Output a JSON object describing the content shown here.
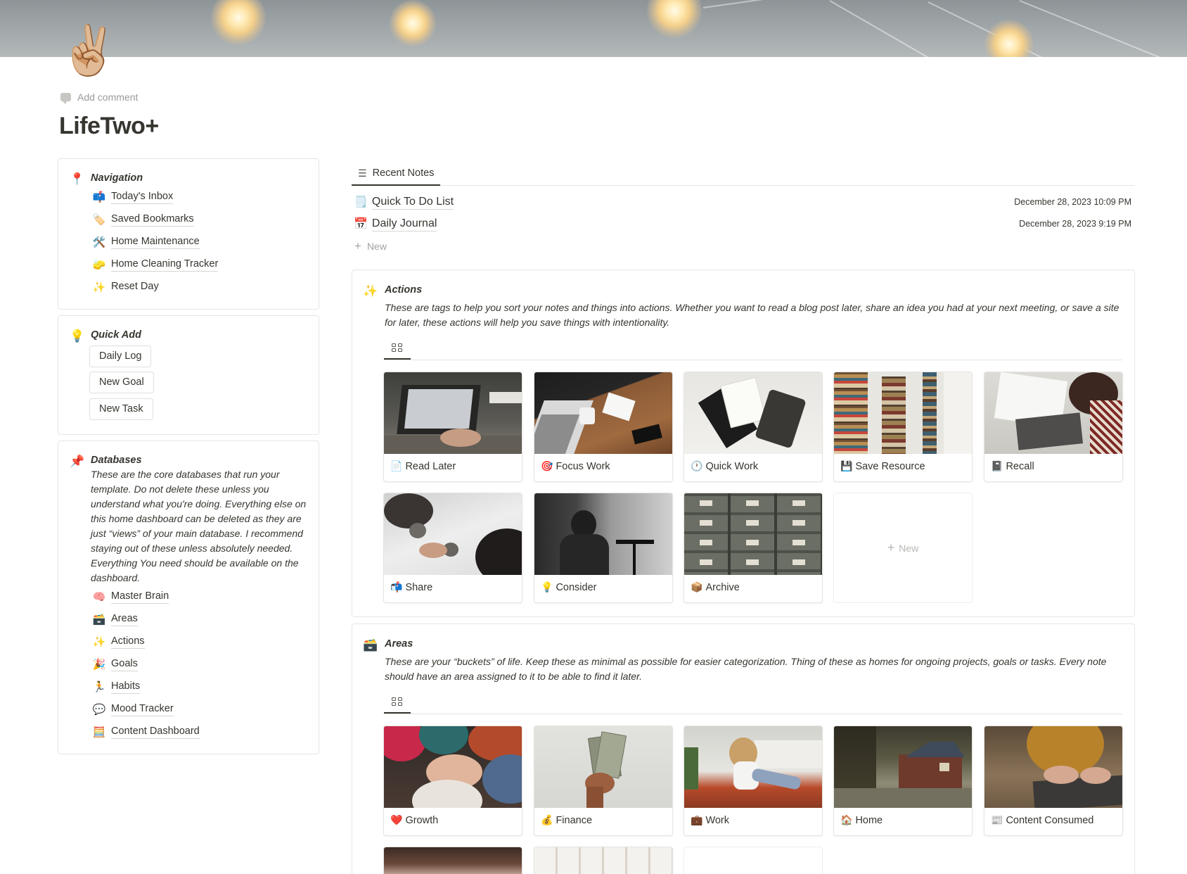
{
  "page": {
    "icon": "✌🏼",
    "add_comment": "Add comment",
    "title": "LifeTwo+"
  },
  "navigation": {
    "icon": "📍",
    "title": "Navigation",
    "items": [
      {
        "icon": "📫",
        "label": "Today's Inbox"
      },
      {
        "icon": "🏷️",
        "label": "Saved Bookmarks"
      },
      {
        "icon": "🛠️",
        "label": "Home Maintenance"
      },
      {
        "icon": "🧽",
        "label": "Home Cleaning Tracker"
      },
      {
        "icon": "✨",
        "label": "Reset Day"
      }
    ]
  },
  "quick_add": {
    "icon": "💡",
    "title": "Quick Add",
    "buttons": [
      "Daily Log",
      "New Goal",
      "New Task"
    ]
  },
  "databases": {
    "icon": "📌",
    "title": "Databases",
    "description": "These are the core databases that run your template. Do not delete these unless you understand what you're doing. Everything else on this home dashboard can be deleted as they are just “views” of your main database. I recommend staying out of these unless absolutely needed. Everything You need should be available on the dashboard.",
    "items": [
      {
        "icon": "🧠",
        "label": "Master Brain"
      },
      {
        "icon": "🗃️",
        "label": "Areas"
      },
      {
        "icon": "✨",
        "label": "Actions"
      },
      {
        "icon": "🎉",
        "label": "Goals"
      },
      {
        "icon": "🏃",
        "label": "Habits"
      },
      {
        "icon": "💬",
        "label": "Mood Tracker"
      },
      {
        "icon": "🧮",
        "label": "Content Dashboard"
      }
    ]
  },
  "recent_notes": {
    "tab_label": "Recent Notes",
    "tab_icon": "list-icon",
    "rows": [
      {
        "icon": "🗒️",
        "title": "Quick To Do List",
        "date": "December 28, 2023 10:09 PM"
      },
      {
        "icon": "📅",
        "title": "Daily Journal",
        "date": "December 28, 2023 9:19 PM"
      }
    ],
    "new_label": "New"
  },
  "actions": {
    "icon": "✨",
    "title": "Actions",
    "description": "These are tags to help you sort your notes and things into actions. Whether you want to read a blog post later, share an idea you had at your next meeting, or save a site for later, these actions will help you save things with intentionality.",
    "view_icon": "gallery-icon",
    "cards": [
      {
        "icon": "📄",
        "label": "Read Later"
      },
      {
        "icon": "🎯",
        "label": "Focus Work"
      },
      {
        "icon": "🕐",
        "label": "Quick Work"
      },
      {
        "icon": "💾",
        "label": "Save Resource"
      },
      {
        "icon": "📓",
        "label": "Recall"
      },
      {
        "icon": "📬",
        "label": "Share"
      },
      {
        "icon": "💡",
        "label": "Consider"
      },
      {
        "icon": "📦",
        "label": "Archive"
      }
    ],
    "new_label": "New"
  },
  "areas": {
    "icon": "🗃️",
    "title": "Areas",
    "description": "These are your “buckets” of life. Keep these as minimal as possible for easier categorization. Thing of these as homes for ongoing projects, goals or tasks. Every note should have an area assigned to it to be able to find it later.",
    "view_icon": "gallery-icon",
    "cards": [
      {
        "icon": "❤️",
        "label": "Growth"
      },
      {
        "icon": "💰",
        "label": "Finance"
      },
      {
        "icon": "💼",
        "label": "Work"
      },
      {
        "icon": "🏠",
        "label": "Home"
      },
      {
        "icon": "📰",
        "label": "Content Consumed"
      }
    ]
  }
}
